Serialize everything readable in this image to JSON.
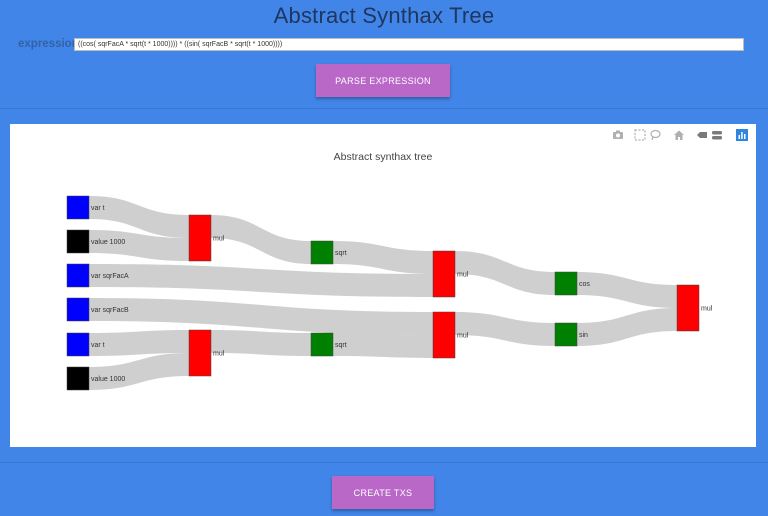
{
  "app": {
    "title": "Abstract Synthax Tree",
    "expression_label": "expression",
    "expression_value": "((cos( sqrFacA * sqrt(t * 1000)))) * ((sin( sqrFacB * sqrt(t * 1000))))",
    "parse_button": "PARSE EXPRESSION",
    "create_button": "CREATE TXS"
  },
  "chart": {
    "title": "Abstract synthax tree",
    "modebar": [
      "camera-icon",
      "box-select-icon",
      "lasso-icon",
      "home-icon",
      "spike-lines-icon",
      "compare-hover-icon",
      "plotly-logo-icon"
    ]
  },
  "colors": {
    "background": "#4285e8",
    "button": "#ba68c8",
    "link": "#cccccc",
    "var": "#0000ff",
    "value": "#000000",
    "func": "#008000",
    "op": "#ff0000"
  },
  "chart_data": {
    "type": "sankey",
    "title": "Abstract synthax tree",
    "nodes": [
      {
        "label": "var t",
        "color": "#0000ff"
      },
      {
        "label": "value 1000",
        "color": "#000000"
      },
      {
        "label": "var sqrFacA",
        "color": "#0000ff"
      },
      {
        "label": "var sqrFacB",
        "color": "#0000ff"
      },
      {
        "label": "var t",
        "color": "#0000ff"
      },
      {
        "label": "value 1000",
        "color": "#000000"
      },
      {
        "label": "mul",
        "color": "#ff0000"
      },
      {
        "label": "mul",
        "color": "#ff0000"
      },
      {
        "label": "sqrt",
        "color": "#008000"
      },
      {
        "label": "sqrt",
        "color": "#008000"
      },
      {
        "label": "mul",
        "color": "#ff0000"
      },
      {
        "label": "mul",
        "color": "#ff0000"
      },
      {
        "label": "cos",
        "color": "#008000"
      },
      {
        "label": "sin",
        "color": "#008000"
      },
      {
        "label": "mul",
        "color": "#ff0000"
      }
    ],
    "links": [
      {
        "source": 0,
        "target": 6,
        "value": 1
      },
      {
        "source": 1,
        "target": 6,
        "value": 1
      },
      {
        "source": 6,
        "target": 8,
        "value": 1
      },
      {
        "source": 8,
        "target": 10,
        "value": 1
      },
      {
        "source": 2,
        "target": 10,
        "value": 1
      },
      {
        "source": 3,
        "target": 11,
        "value": 1
      },
      {
        "source": 4,
        "target": 7,
        "value": 1
      },
      {
        "source": 5,
        "target": 7,
        "value": 1
      },
      {
        "source": 7,
        "target": 9,
        "value": 1
      },
      {
        "source": 9,
        "target": 11,
        "value": 1
      },
      {
        "source": 10,
        "target": 12,
        "value": 1
      },
      {
        "source": 11,
        "target": 13,
        "value": 1
      },
      {
        "source": 12,
        "target": 14,
        "value": 1
      },
      {
        "source": 13,
        "target": 14,
        "value": 1
      }
    ]
  }
}
